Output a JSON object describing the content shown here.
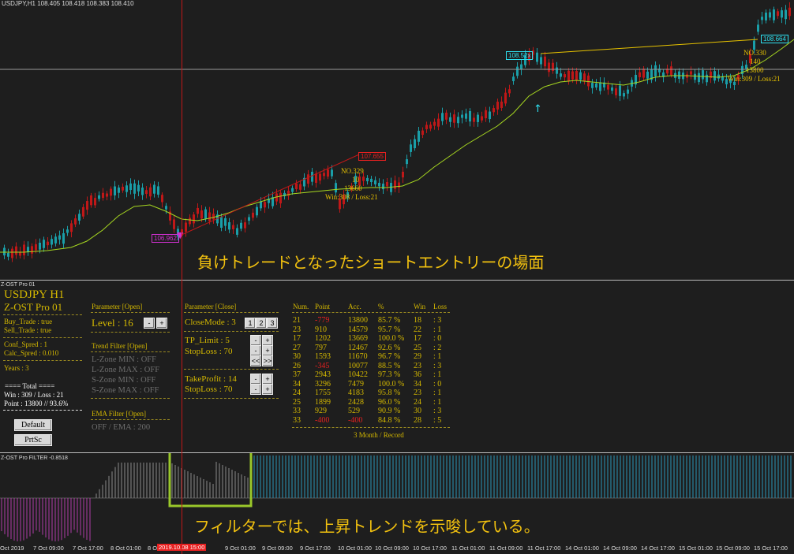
{
  "chart": {
    "symbol_header": "USDJPY,H1  108.405 108.418 108.383 108.410",
    "price_tags": {
      "tag1": "108.52x",
      "tag2": "108.664",
      "tag3": "107.655",
      "tag4": "106.962"
    },
    "annotation_right": [
      "NO.330",
      "140",
      "13800",
      "Win:309 / Loss:21"
    ],
    "annotation_mid": [
      "NO.329",
      "10",
      "13660",
      "Win:308 / Loss:21"
    ],
    "caption_top": "負けトレードとなったショートエントリーの場面",
    "colors": {
      "bull": "#1a9ea8",
      "bear": "#c01818",
      "ma": "#a7d820",
      "trend": "#e6c200"
    }
  },
  "panel": {
    "title": "Z-OST Pro 01",
    "symbol": "USDJPY H1",
    "product": "Z-OST Pro 01",
    "buy_trade": "Buy_Trade : true",
    "sell_trade": "Sell_Trade : true",
    "conf_spred": "Conf_Spred : 1",
    "calc_spred": "Calc_Spred : 0.010",
    "years": "Years : 3",
    "total_header": "==== Total ====",
    "win_loss": "Win : 309  /  Loss : 21",
    "point": "Point : 13800 // 93.6%",
    "default_btn": "Default",
    "prtsc_btn": "PrtSc",
    "param_open_header": "Parameter [Open]",
    "level_label": "Level : 16",
    "trend_filter_header": "Trend Filter [Open]",
    "lzone_min": "L-Zone MIN  :  OFF",
    "lzone_max": "L-Zone MAX : OFF",
    "szone_min": "S-Zone MIN  :  OFF",
    "szone_max": "S-Zone MAX : OFF",
    "ema_header": "EMA Filter [Open]",
    "ema_value": "OFF  /   EMA : 200",
    "param_close_header": "Parameter [Close]",
    "closemode_label": "CloseMode : 3",
    "mode_buttons": [
      "1",
      "2",
      "3"
    ],
    "tp_limit": "TP_Limit : 5",
    "stoploss1": "StopLoss : 70",
    "takeprofit": "TakeProfit : 14",
    "stoploss2": "StopLoss : 70",
    "minus": "-",
    "plus": "+",
    "prev": "<<",
    "next": ">>"
  },
  "table": {
    "headers": [
      "Num.",
      "Point",
      "Acc.",
      "%",
      "Win",
      "Loss"
    ],
    "rows": [
      {
        "num": "21",
        "point": "-779",
        "acc": "13800",
        "pct": "85.7  %",
        "win": "18",
        "loss": ": 3",
        "neg": true
      },
      {
        "num": "23",
        "point": "910",
        "acc": "14579",
        "pct": "95.7  %",
        "win": "22",
        "loss": ": 1",
        "neg": false
      },
      {
        "num": "17",
        "point": "1202",
        "acc": "13669",
        "pct": "100.0  %",
        "win": "17",
        "loss": ": 0",
        "neg": false
      },
      {
        "num": "27",
        "point": "797",
        "acc": "12467",
        "pct": "92.6  %",
        "win": "25",
        "loss": ": 2",
        "neg": false
      },
      {
        "num": "30",
        "point": "1593",
        "acc": "11670",
        "pct": "96.7  %",
        "win": "29",
        "loss": ": 1",
        "neg": false
      },
      {
        "num": "26",
        "point": "-345",
        "acc": "10077",
        "pct": "88.5  %",
        "win": "23",
        "loss": ": 3",
        "neg": true
      },
      {
        "num": "37",
        "point": "2943",
        "acc": "10422",
        "pct": "97.3  %",
        "win": "36",
        "loss": ": 1",
        "neg": false
      },
      {
        "num": "34",
        "point": "3296",
        "acc": "7479",
        "pct": "100.0  %",
        "win": "34",
        "loss": ": 0",
        "neg": false
      },
      {
        "num": "24",
        "point": "1755",
        "acc": "4183",
        "pct": "95.8  %",
        "win": "23",
        "loss": ": 1",
        "neg": false
      },
      {
        "num": "25",
        "point": "1899",
        "acc": "2428",
        "pct": "96.0  %",
        "win": "24",
        "loss": ": 1",
        "neg": false
      },
      {
        "num": "33",
        "point": "929",
        "acc": "529",
        "pct": "90.9  %",
        "win": "30",
        "loss": ": 3",
        "neg": false
      },
      {
        "num": "33",
        "point": "-400",
        "acc": "-400",
        "pct": "84.8  %",
        "win": "28",
        "loss": ": 5",
        "neg": true
      }
    ],
    "footer": "3 Month / Record"
  },
  "filter": {
    "title": "Z-OST Pro FILTER -0.8518",
    "caption": "フィルターでは、上昇トレンドを示唆している。"
  },
  "time_axis": [
    "Oct 2019",
    "7 Oct 09:00",
    "7 Oct 17:00",
    "8 Oct 01:00",
    "8 O",
    "9 Oct 01:00",
    "9 Oct 09:00",
    "9 Oct 17:00",
    "10 Oct 01:00",
    "10 Oct 09:00",
    "10 Oct 17:00",
    "11 Oct 01:00",
    "11 Oct 09:00",
    "11 Oct 17:00",
    "14 Oct 01:00",
    "14 Oct 09:00",
    "14 Oct 17:00",
    "15 Oct 01:00",
    "15 Oct 09:00",
    "15 Oct 17:00"
  ],
  "time_axis_highlight": "2019.10.08 15:00"
}
